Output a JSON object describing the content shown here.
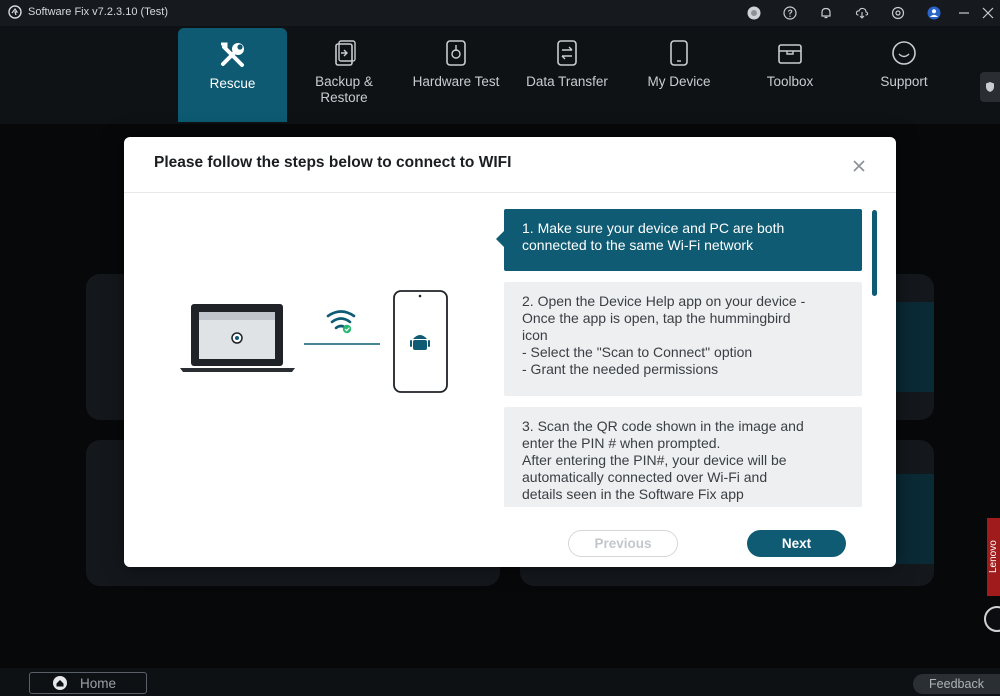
{
  "app": {
    "title": "Software Fix v7.2.3.10 (Test)"
  },
  "titlebar_icons": [
    "record-icon",
    "help-icon",
    "bell-icon",
    "cloud-download-icon",
    "settings-icon",
    "user-icon",
    "minimize-icon",
    "close-icon"
  ],
  "nav": {
    "items": [
      {
        "label": "Rescue",
        "icon": "wrench-screwdriver-icon",
        "active": true
      },
      {
        "label": "Backup &\nRestore",
        "icon": "backup-restore-icon",
        "active": false
      },
      {
        "label": "Hardware Test",
        "icon": "hardware-test-icon",
        "active": false
      },
      {
        "label": "Data Transfer",
        "icon": "data-transfer-icon",
        "active": false
      },
      {
        "label": "My Device",
        "icon": "phone-icon",
        "active": false
      },
      {
        "label": "Toolbox",
        "icon": "toolbox-icon",
        "active": false
      },
      {
        "label": "Support",
        "icon": "chat-support-icon",
        "active": false
      }
    ]
  },
  "modal": {
    "title": "Please follow the steps below to connect to WIFI",
    "steps": [
      {
        "text": "1. Make sure your device and PC are both\n    connected to the same Wi-Fi network",
        "active": true
      },
      {
        "text": "2. Open the Device Help app on your device -\n    Once the app is open, tap the hummingbird\n    icon\n    - Select the \"Scan to Connect\" option\n    - Grant the needed permissions",
        "active": false
      },
      {
        "text": "3. Scan the QR code shown in the image and\n    enter the PIN # when prompted.\n    After entering the PIN#, your device will be\n    automatically connected over Wi-Fi and\n    details seen in the Software Fix app",
        "active": false
      }
    ],
    "previous_label": "Previous",
    "next_label": "Next"
  },
  "bottom": {
    "home_label": "Home",
    "feedback_label": "Feedback"
  },
  "side": {
    "lenovo_label": "Lenovo"
  },
  "colors": {
    "accent": "#0e5b73",
    "background": "#0b0d10",
    "inactive_step": "#edeff1"
  }
}
